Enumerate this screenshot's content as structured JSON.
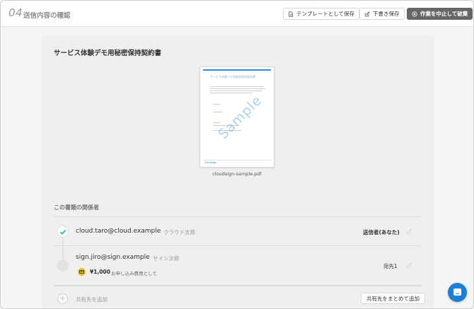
{
  "header": {
    "step_number": "04",
    "step_title": "送信内容の確認",
    "save_template_label": "テンプレートとして保存",
    "save_draft_label": "下書き保存",
    "discard_label": "作業を中止して破棄"
  },
  "document": {
    "title": "サービス体験デモ用秘密保持契約書",
    "file_name": "cloudsign-sample.pdf",
    "watermark": "Sample",
    "thumb_title": "サービス体験デモ用秘密保持契約書",
    "thumb_footer": "Cloudsign"
  },
  "parties": {
    "section_title": "この書類の関係者",
    "sender": {
      "email": "cloud.taro@cloud.example",
      "name": "クラウド太郎",
      "role": "送信者(あなた)"
    },
    "recipient": {
      "email": "sign.jiro@sign.example",
      "name": "サイン次郎",
      "role": "宛先1",
      "fee_amount": "¥1,000",
      "fee_note": "お申し込み費用として"
    },
    "add_share_label": "共有先を追加",
    "bulk_share_label": "共有先をまとめて追加"
  },
  "colors": {
    "accent": "#2b8fd6",
    "check": "#26b5c7",
    "fee": "#f0c419",
    "chat": "#1a7fd6"
  }
}
